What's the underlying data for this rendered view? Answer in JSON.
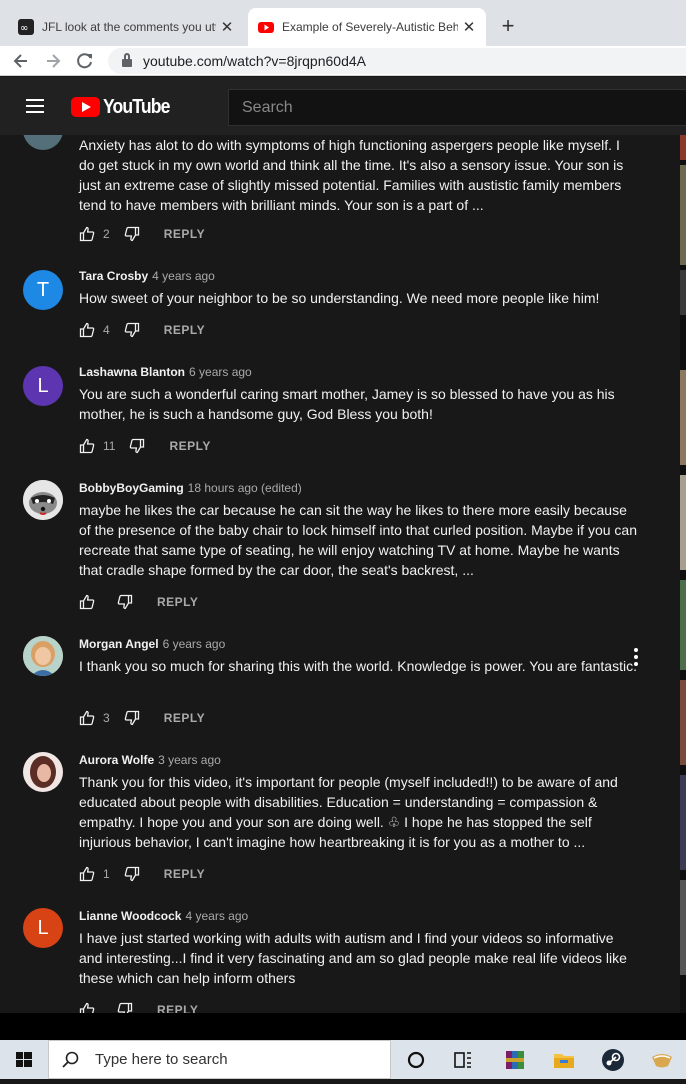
{
  "browser": {
    "tabs": [
      {
        "title": "JFL look at the comments you utt"
      },
      {
        "title": "Example of Severely-Autistic Beh"
      }
    ],
    "new_tab_label": "+",
    "close_glyph": "✕",
    "url": "youtube.com/watch?v=8jrqpn60d4A"
  },
  "youtube": {
    "logo_text": "YouTube",
    "search_placeholder": "Search",
    "reply_label": "REPLY"
  },
  "comments": [
    {
      "author": "",
      "time": "",
      "avatar_letter": "",
      "avatar_color": "#546e7a",
      "text": "Anxiety has alot to do with symptoms of high functioning aspergers people like myself. I do get stuck in my own world and think all the time. It's also a sensory issue. Your son is just an extreme case of slightly missed potential. Families with austistic family members tend to have members with brilliant minds. Your son is a part of ...",
      "likes": "2"
    },
    {
      "author": "Tara Crosby",
      "time": "4 years ago",
      "avatar_letter": "T",
      "avatar_color": "#1e88e5",
      "text": "How sweet of  your neighbor to be so understanding.  We need more people like him!",
      "likes": "4"
    },
    {
      "author": "Lashawna Blanton",
      "time": "6 years ago",
      "avatar_letter": "L",
      "avatar_color": "#5e35b1",
      "text": "You are such a wonderful caring smart mother, Jamey is so blessed to have you as his mother, he is such a handsome guy, God Bless you both!",
      "likes": "11"
    },
    {
      "author": "BobbyBoyGaming",
      "time": "18 hours ago (edited)",
      "avatar_letter": "",
      "avatar_color": "#d7d7d7",
      "text": "maybe he likes the car because he can sit the way he likes to there more easily because of the presence of the baby chair to lock himself into that curled position. Maybe if you can recreate that same type of seating, he will enjoy watching TV at home. Maybe he wants that cradle shape formed by the car door, the seat's backrest, ...",
      "likes": ""
    },
    {
      "author": "Morgan Angel",
      "time": "6 years ago",
      "avatar_letter": "",
      "avatar_color": "#c9a27a",
      "text": "I thank you so much for sharing this with the world.  Knowledge is power.  You are fantastic.",
      "likes": "3"
    },
    {
      "author": "Aurora Wolfe",
      "time": "3 years ago",
      "avatar_letter": "",
      "avatar_color": "#6b3b34",
      "text": "Thank you for this video, it's important for people (myself included!!) to be aware of and educated about people with disabilities. Education = understanding = compassion & empathy. I hope you and your son are doing well. ♧ I hope he has stopped the self injurious behavior, I can't imagine how heartbreaking it is for you as a mother to ...",
      "likes": "1"
    },
    {
      "author": "Lianne Woodcock",
      "time": "4 years ago",
      "avatar_letter": "L",
      "avatar_color": "#d84315",
      "text": "I have just started working with adults with autism and I find your videos so informative and interesting...I find it very fascinating and am so glad people make real life videos like these which can help inform others",
      "likes": ""
    }
  ],
  "taskbar": {
    "search_placeholder": "Type here to search"
  },
  "colors": {
    "yt_red": "#ff0000",
    "page_bg": "#181818",
    "header_bg": "#212121"
  }
}
